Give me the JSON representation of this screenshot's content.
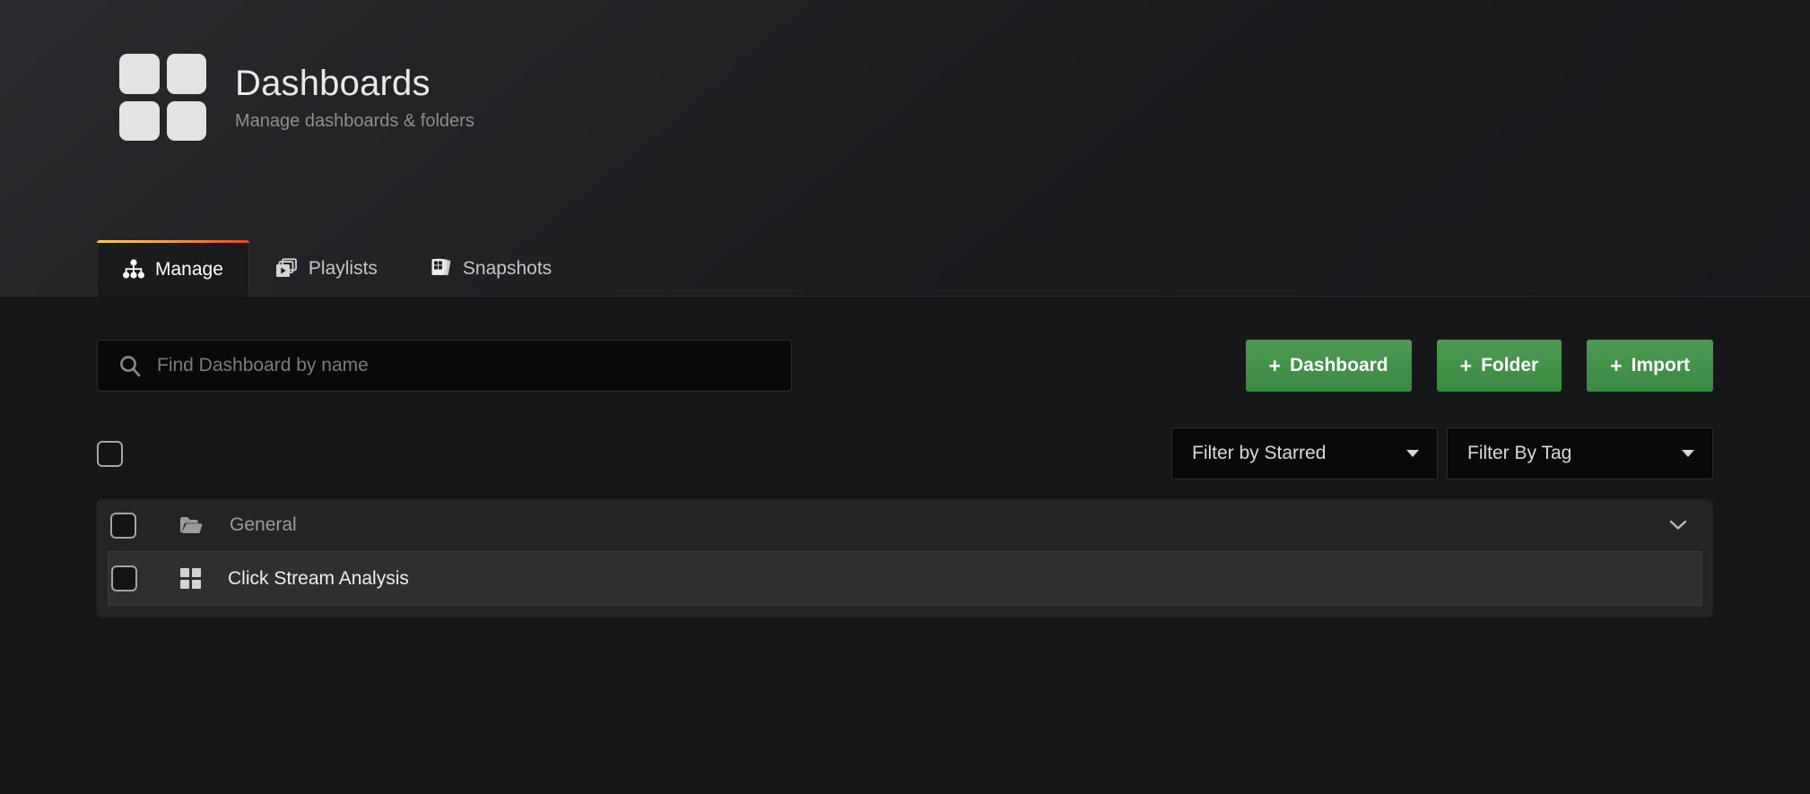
{
  "header": {
    "icon": "dashboards-grid-icon",
    "title": "Dashboards",
    "subtitle": "Manage dashboards & folders"
  },
  "tabs": [
    {
      "label": "Manage",
      "icon": "sitemap-icon",
      "active": true
    },
    {
      "label": "Playlists",
      "icon": "playlist-icon",
      "active": false
    },
    {
      "label": "Snapshots",
      "icon": "snapshots-icon",
      "active": false
    }
  ],
  "search": {
    "placeholder": "Find Dashboard by name",
    "value": "",
    "icon": "search-icon"
  },
  "actions": [
    {
      "label": "Dashboard",
      "plus": "+"
    },
    {
      "label": "Folder",
      "plus": "+"
    },
    {
      "label": "Import",
      "plus": "+"
    }
  ],
  "filters": [
    {
      "label": "Filter by Starred",
      "icon": "chevron-down-icon"
    },
    {
      "label": "Filter By Tag",
      "icon": "chevron-down-icon"
    }
  ],
  "list": {
    "select_all_checked": false,
    "folders": [
      {
        "name": "General",
        "icon": "folder-open-icon",
        "checked": false,
        "expanded": true,
        "chevron": "chevron-down-icon",
        "dashboards": [
          {
            "name": "Click Stream Analysis",
            "icon": "dashboard-grid-icon",
            "checked": false,
            "highlighted": true
          }
        ]
      }
    ]
  },
  "colors": {
    "page_background": "#161719",
    "header_background": "#1d1d20",
    "accent_gradient_start": "#f2cc4b",
    "accent_gradient_end": "#e8452a",
    "button_green": "#3b8a41",
    "row_background": "#242426",
    "row_highlight": "#2f2f31",
    "text_primary": "#d8d9da",
    "text_muted": "#8e8e8e"
  }
}
